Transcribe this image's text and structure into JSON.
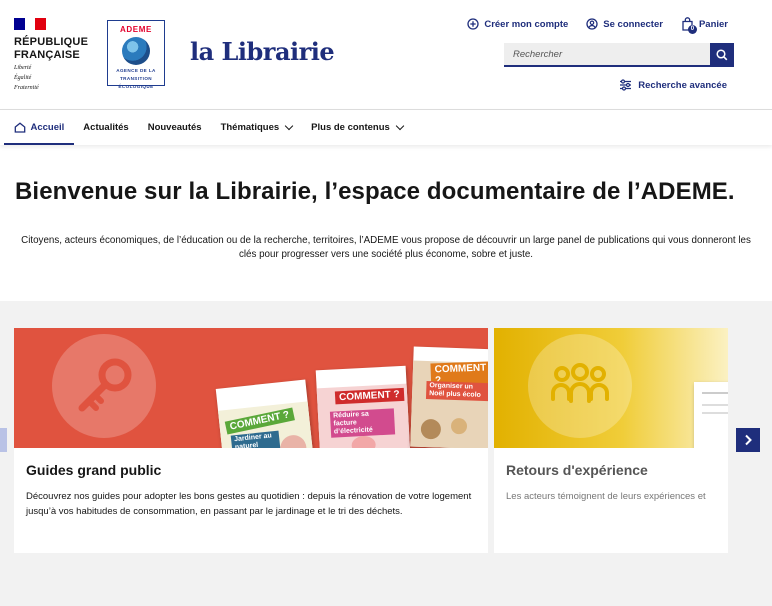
{
  "header": {
    "republic": {
      "line1": "République",
      "line2": "Française",
      "motto": [
        "Liberté",
        "Égalité",
        "Fraternité"
      ]
    },
    "ademe_logo": {
      "name": "ADEME",
      "subtitle": [
        "AGENCE DE LA",
        "TRANSITION",
        "ÉCOLOGIQUE"
      ]
    },
    "brand": "la Librairie",
    "quicklinks": [
      {
        "label": "Créer mon compte",
        "icon": "plus-circle-icon"
      },
      {
        "label": "Se connecter",
        "icon": "user-circle-icon"
      },
      {
        "label": "Panier",
        "icon": "cart-icon",
        "badge": "0"
      }
    ],
    "search": {
      "placeholder": "Rechercher"
    },
    "advanced_search": "Recherche avancée"
  },
  "nav": {
    "items": [
      {
        "label": "Accueil",
        "icon": "home-icon",
        "active": true
      },
      {
        "label": "Actualités"
      },
      {
        "label": "Nouveautés"
      },
      {
        "label": "Thématiques",
        "dropdown": true
      },
      {
        "label": "Plus de contenus",
        "dropdown": true
      }
    ]
  },
  "hero": {
    "title": "Bienvenue sur la Librairie, l’espace documentaire de l’ADEME.",
    "text": "Citoyens, acteurs économiques, de l’éducation ou de la recherche, territoires, l’ADEME vous propose de découvrir un large panel de publications qui vous donneront les clés pour progresser vers une société plus économe, sobre et juste."
  },
  "cards": [
    {
      "title": "Guides grand public",
      "description": "Découvrez nos guides pour adopter les bons gestes au quotidien : depuis la rénovation de votre logement jusqu’à vos habitudes de consommation, en passant par le jardinage et le tri des déchets.",
      "icon": "key-icon",
      "color": "#e0533f",
      "books": [
        {
          "title": "COMMENT ?",
          "subtitle": "Jardiner au naturel"
        },
        {
          "title": "COMMENT ?",
          "subtitle": "Réduire sa facture d’électricité"
        },
        {
          "title": "COMMENT ?",
          "subtitle": "Organiser un Noël plus écolo"
        }
      ]
    },
    {
      "title": "Retours d'expérience",
      "description": "Les acteurs témoignent de leurs expériences et ",
      "icon": "people-group-icon",
      "color": "#e2b100"
    }
  ],
  "carousel": {
    "next_icon": "chevron-right-icon",
    "prev_icon": "chevron-left-icon"
  },
  "colors": {
    "primary": "#1f2e7c",
    "flag_blue": "#000091",
    "flag_red": "#e1000f"
  }
}
